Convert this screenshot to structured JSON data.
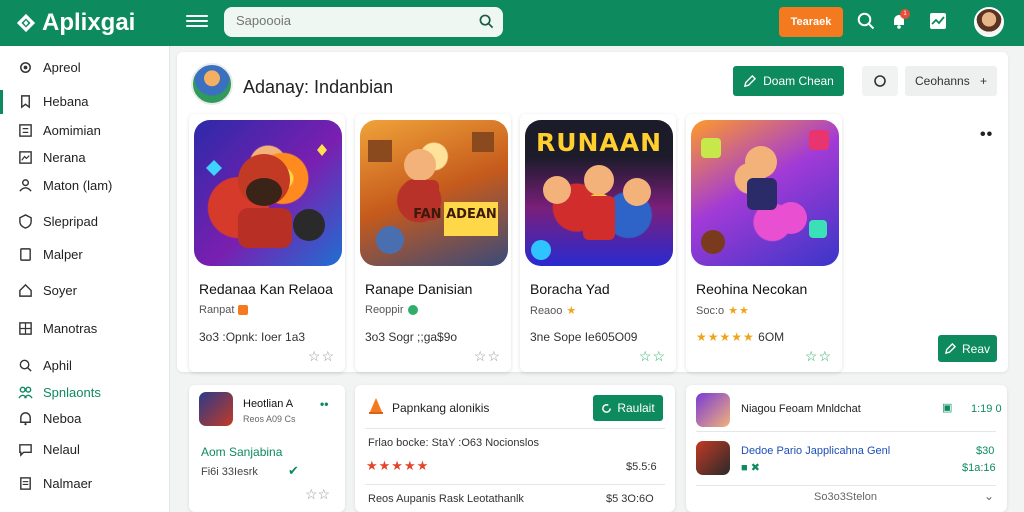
{
  "topbar": {
    "app_name": "Aplixgai",
    "search_placeholder": "Sapoooia",
    "cta_label": "Tearaek",
    "notification_count": "1",
    "icons": [
      "menu-icon",
      "search-icon",
      "notification-icon",
      "chart-icon"
    ]
  },
  "sidebar": {
    "items": [
      {
        "label": "Apreol",
        "icon": "gear-icon"
      },
      {
        "label": "Hebana",
        "icon": "bookmark-icon"
      },
      {
        "label": "Aomimian",
        "icon": "list-icon"
      },
      {
        "label": "Nerana",
        "icon": "image-icon"
      },
      {
        "label": "Maton (lam)",
        "icon": "user-icon"
      },
      {
        "label": "Slepripad",
        "icon": "shield-icon"
      },
      {
        "label": "Malper",
        "icon": "square-icon"
      },
      {
        "label": "Soyer",
        "icon": "home-icon"
      },
      {
        "label": "Manotras",
        "icon": "grid-icon"
      },
      {
        "label": "Aphil",
        "icon": "search-icon"
      },
      {
        "label": "Spnlaonts",
        "icon": "people-icon"
      },
      {
        "label": "Neboa",
        "icon": "bell-icon"
      },
      {
        "label": "Nelaul",
        "icon": "chat-icon"
      },
      {
        "label": "Nalmaer",
        "icon": "document-icon"
      }
    ]
  },
  "main": {
    "title": "Adanay: Indanbian",
    "primary_button": "Doam Chean",
    "secondary_button": "Ceohanns",
    "secondary_button_suffix": "+",
    "view_button": "Reav",
    "games": [
      {
        "title": "Redanaa Kan Relaoa",
        "subtitle": "Ranpat",
        "meta": "3o3 :Opnk: Ioer 1a3",
        "art_text": ""
      },
      {
        "title": "Ranape Danisian",
        "subtitle": "Reoppir",
        "meta": "3o3 Sogr ;;ga$9o",
        "art_text": "FAN ADEAN"
      },
      {
        "title": "Boracha Yad",
        "subtitle": "Reaoo",
        "meta": "3ne Sope Ie605O09",
        "art_text": "RUNAAN"
      },
      {
        "title": "Reohina Necokan",
        "subtitle": "Soc:o",
        "meta": "6OM",
        "art_text": ""
      }
    ]
  },
  "bottom": {
    "card1": {
      "title": "Heotlian A",
      "subtitle": "Reos A09 Cs",
      "highlight": "Aom Sanjabina",
      "meta": "Fi6i 33Iesrk"
    },
    "card2": {
      "header": "Papnkang alonikis",
      "button": "Raulait",
      "line1": "Frlao bocke: StaY :O63 Nocionslos",
      "line1_price": "$5.5:6",
      "line2": "Reos Aupanis Rask Leotathanlk",
      "line2_price": "$5 3O:6O"
    },
    "card3": {
      "title": "Niagou Feoam Mnldchat",
      "title_value": "1:19 0",
      "link": "Dedoe Pario Japplicahna Genl",
      "price_top": "$30",
      "price_bottom": "$1a:16",
      "footer": "So3o3Stelon"
    }
  },
  "colors": {
    "primary": "#0e8a5f",
    "accent": "#f47a1f",
    "star": "#f0a41c",
    "alert": "#e94d3a"
  }
}
